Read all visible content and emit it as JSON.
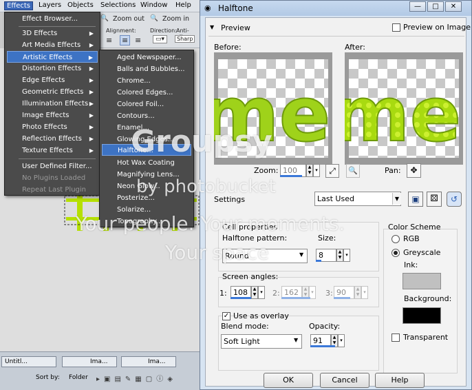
{
  "menubar": {
    "items": [
      "Effects",
      "Layers",
      "Objects",
      "Selections",
      "Window",
      "Help"
    ]
  },
  "toolbar": {
    "zoom_out": "Zoom out",
    "zoom_in": "Zoom in",
    "alignment": "Alignment:",
    "direction": "Direction:",
    "antialias": "Anti-alias",
    "antialias_value": "Sharp"
  },
  "effects_menu": {
    "items": [
      {
        "label": "Effect Browser...",
        "submenu": false,
        "disabled": false,
        "highlighted": false
      },
      {
        "label": "3D Effects",
        "submenu": true,
        "disabled": false,
        "highlighted": false
      },
      {
        "label": "Art Media Effects",
        "submenu": true,
        "disabled": false,
        "highlighted": false
      },
      {
        "label": "Artistic Effects",
        "submenu": true,
        "disabled": false,
        "highlighted": true
      },
      {
        "label": "Distortion Effects",
        "submenu": true,
        "disabled": false,
        "highlighted": false
      },
      {
        "label": "Edge Effects",
        "submenu": true,
        "disabled": false,
        "highlighted": false
      },
      {
        "label": "Geometric Effects",
        "submenu": true,
        "disabled": false,
        "highlighted": false
      },
      {
        "label": "Illumination Effects",
        "submenu": true,
        "disabled": false,
        "highlighted": false
      },
      {
        "label": "Image Effects",
        "submenu": true,
        "disabled": false,
        "highlighted": false
      },
      {
        "label": "Photo Effects",
        "submenu": true,
        "disabled": false,
        "highlighted": false
      },
      {
        "label": "Reflection Effects",
        "submenu": true,
        "disabled": false,
        "highlighted": false
      },
      {
        "label": "Texture Effects",
        "submenu": true,
        "disabled": false,
        "highlighted": false
      },
      {
        "label": "User Defined Filter...",
        "submenu": false,
        "disabled": false,
        "highlighted": false
      },
      {
        "label": "No Plugins Loaded",
        "submenu": false,
        "disabled": true,
        "highlighted": false
      },
      {
        "label": "Repeat Last Plugin",
        "submenu": false,
        "disabled": true,
        "highlighted": false
      }
    ]
  },
  "artistic_menu": {
    "items": [
      {
        "label": "Aged Newspaper...",
        "highlighted": false
      },
      {
        "label": "Balls and Bubbles...",
        "highlighted": false
      },
      {
        "label": "Chrome...",
        "highlighted": false
      },
      {
        "label": "Colored Edges...",
        "highlighted": false
      },
      {
        "label": "Colored Foil...",
        "highlighted": false
      },
      {
        "label": "Contours...",
        "highlighted": false
      },
      {
        "label": "Enamel...",
        "highlighted": false
      },
      {
        "label": "Glowing Edges...",
        "highlighted": false
      },
      {
        "label": "Halftone...",
        "highlighted": true
      },
      {
        "label": "Hot Wax Coating",
        "highlighted": false
      },
      {
        "label": "Magnifying Lens...",
        "highlighted": false
      },
      {
        "label": "Neon Glow...",
        "highlighted": false
      },
      {
        "label": "Posterize...",
        "highlighted": false
      },
      {
        "label": "Solarize...",
        "highlighted": false
      },
      {
        "label": "Topography...",
        "highlighted": false
      }
    ]
  },
  "taskbar": {
    "tab1": "Untitl...",
    "tab2": "Ima...",
    "tab3": "Ima...",
    "sort_by": "Sort by:",
    "folder": "Folder"
  },
  "dialog": {
    "title": "Halftone",
    "window_buttons": {
      "minimize": "—",
      "maximize": "□",
      "close": "✕"
    },
    "preview_header": "Preview",
    "preview_on_image": "Preview on Image",
    "preview_on_image_checked": false,
    "before_label": "Before:",
    "after_label": "After:",
    "zoom_label": "Zoom:",
    "zoom_value": "100",
    "pan_label": "Pan:",
    "settings_label": "Settings",
    "settings_value": "Last Used",
    "cell_properties": "Cell properties",
    "halftone_pattern_label": "Halftone pattern:",
    "halftone_pattern_value": "Round",
    "size_label": "Size:",
    "size_value": "8",
    "screen_angles_label": "Screen angles:",
    "angles": [
      {
        "idx": "1:",
        "value": "108",
        "enabled": true
      },
      {
        "idx": "2:",
        "value": "162",
        "enabled": false
      },
      {
        "idx": "3:",
        "value": "90",
        "enabled": false
      }
    ],
    "use_as_overlay": "Use as overlay",
    "use_as_overlay_checked": true,
    "blend_mode_label": "Blend mode:",
    "blend_mode_value": "Soft Light",
    "opacity_label": "Opacity:",
    "opacity_value": "91",
    "color_scheme": "Color Scheme",
    "rgb_label": "RGB",
    "greyscale_label": "Greyscale",
    "color_mode_selected": "Greyscale",
    "ink_label": "Ink:",
    "ink_color": "#c0c0c0",
    "background_label": "Background:",
    "background_color": "#000000",
    "transparent_label": "Transparent",
    "transparent_checked": false,
    "ok": "OK",
    "cancel": "Cancel",
    "help": "Help",
    "preview_text": "mel"
  },
  "watermark": {
    "line1": "Groupsy",
    "line2": "by photobucket",
    "line3": "Your people. Your moments.",
    "line4": "Your space"
  },
  "colors": {
    "lime": "#b6e000",
    "menu_bg": "#4b4b4b",
    "highlight": "#3d73c4"
  }
}
